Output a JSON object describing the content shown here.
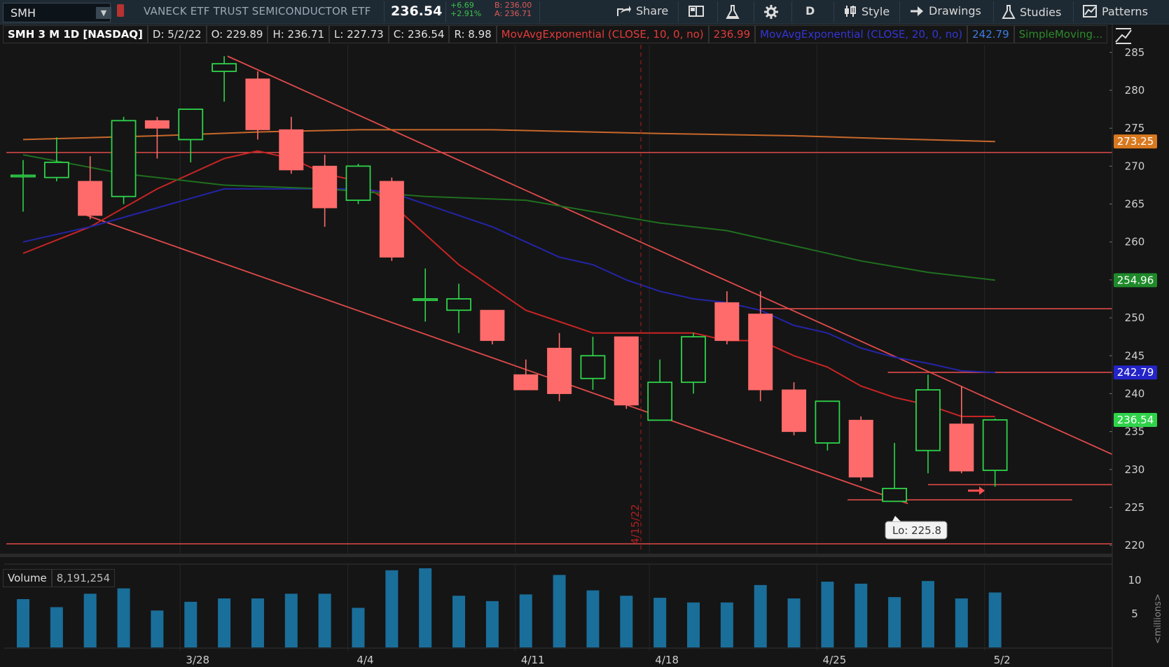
{
  "toolbar": {
    "symbol": "SMH",
    "description": "VANECK ETF TRUST SEMICONDUCTOR ETF",
    "last": "236.54",
    "change": "+6.69",
    "change_pct": "+2.91%",
    "bid": "B: 236.00",
    "ask": "A: 236.71",
    "share_label": "Share",
    "period_label": "D",
    "style_label": "Style",
    "drawings_label": "Drawings",
    "studies_label": "Studies",
    "patterns_label": "Patterns"
  },
  "infobar": {
    "title": "SMH 3 M 1D [NASDAQ]",
    "date": "D: 5/2/22",
    "open": "O: 229.89",
    "high": "H: 236.71",
    "low": "L: 227.73",
    "close": "C: 236.54",
    "range": "R: 8.98",
    "ema10_label": "MovAvgExponential (CLOSE, 10, 0, no)",
    "ema10_value": "236.99",
    "ema20_label": "MovAvgExponential (CLOSE, 20, 0, no)",
    "ema20_value": "242.79",
    "sma_label": "SimpleMoving..."
  },
  "volume_panel": {
    "label": "Volume",
    "value": "8,191,254",
    "unit_label": "<millions>"
  },
  "annotations": {
    "low_label": "Lo: 225.8",
    "vline_label": "4/15/22"
  },
  "colors": {
    "up": "#2fd34a",
    "down": "#ff6b6b",
    "ema10": "#c82424",
    "ema20": "#2424a8",
    "sma_green": "#1f6f1f",
    "sma_orange": "#c8682a",
    "trendline": "#e04a4a",
    "volume": "#1a6e9a",
    "background": "#151515"
  },
  "chart_data": {
    "type": "candlestick",
    "title": "SMH 3 M 1D [NASDAQ]",
    "ylim": [
      219,
      286
    ],
    "yticks": [
      220,
      225,
      230,
      235,
      240,
      245,
      250,
      255,
      260,
      265,
      270,
      275,
      280,
      285
    ],
    "x_tick_labels": [
      {
        "label": "3/28",
        "index": 5
      },
      {
        "label": "4/4",
        "index": 10
      },
      {
        "label": "4/11",
        "index": 15
      },
      {
        "label": "4/18",
        "index": 19
      },
      {
        "label": "4/25",
        "index": 24
      },
      {
        "label": "5/2",
        "index": 29
      }
    ],
    "candles": [
      {
        "o": 268.6,
        "h": 270.8,
        "l": 264.0,
        "c": 268.8
      },
      {
        "o": 268.5,
        "h": 273.8,
        "l": 268.0,
        "c": 270.5
      },
      {
        "o": 268.0,
        "h": 271.3,
        "l": 263.0,
        "c": 263.5
      },
      {
        "o": 266.0,
        "h": 276.5,
        "l": 265.0,
        "c": 276.0
      },
      {
        "o": 276.0,
        "h": 276.5,
        "l": 271.0,
        "c": 275.0
      },
      {
        "o": 273.5,
        "h": 277.5,
        "l": 270.5,
        "c": 277.5
      },
      {
        "o": 282.5,
        "h": 284.5,
        "l": 278.5,
        "c": 283.5
      },
      {
        "o": 281.5,
        "h": 282.5,
        "l": 273.5,
        "c": 274.8
      },
      {
        "o": 274.8,
        "h": 276.5,
        "l": 269.0,
        "c": 269.5
      },
      {
        "o": 270.0,
        "h": 271.5,
        "l": 262.0,
        "c": 264.5
      },
      {
        "o": 265.5,
        "h": 270.3,
        "l": 265.0,
        "c": 270.0
      },
      {
        "o": 268.0,
        "h": 268.5,
        "l": 257.5,
        "c": 258.0
      },
      {
        "o": 252.3,
        "h": 256.5,
        "l": 249.5,
        "c": 252.5
      },
      {
        "o": 251.0,
        "h": 254.5,
        "l": 248.0,
        "c": 252.5
      },
      {
        "o": 251.0,
        "h": 251.0,
        "l": 246.5,
        "c": 247.0
      },
      {
        "o": 242.5,
        "h": 244.5,
        "l": 240.5,
        "c": 240.5
      },
      {
        "o": 246.0,
        "h": 248.0,
        "l": 239.0,
        "c": 240.0
      },
      {
        "o": 242.0,
        "h": 247.5,
        "l": 240.5,
        "c": 245.0
      },
      {
        "o": 247.5,
        "h": 247.5,
        "l": 238.0,
        "c": 238.5
      },
      {
        "o": 236.5,
        "h": 244.5,
        "l": 236.5,
        "c": 241.5
      },
      {
        "o": 241.5,
        "h": 248.0,
        "l": 240.0,
        "c": 247.5
      },
      {
        "o": 252.0,
        "h": 253.5,
        "l": 246.5,
        "c": 247.0
      },
      {
        "o": 250.5,
        "h": 253.5,
        "l": 239.0,
        "c": 240.5
      },
      {
        "o": 240.5,
        "h": 241.5,
        "l": 234.5,
        "c": 235.0
      },
      {
        "o": 233.5,
        "h": 239.0,
        "l": 232.5,
        "c": 239.0
      },
      {
        "o": 236.5,
        "h": 237.0,
        "l": 228.5,
        "c": 229.0
      },
      {
        "o": 225.8,
        "h": 233.5,
        "l": 225.8,
        "c": 227.5
      },
      {
        "o": 232.5,
        "h": 242.5,
        "l": 229.5,
        "c": 240.5
      },
      {
        "o": 236.0,
        "h": 241.0,
        "l": 229.5,
        "c": 229.8
      },
      {
        "o": 229.89,
        "h": 236.71,
        "l": 227.73,
        "c": 236.54
      }
    ],
    "volume": {
      "ylim": [
        0,
        12
      ],
      "yticks": [
        5,
        10
      ],
      "values": [
        7.2,
        6.0,
        8.0,
        8.8,
        5.5,
        6.8,
        7.3,
        7.3,
        8.0,
        8.0,
        5.9,
        11.5,
        11.8,
        7.7,
        6.9,
        7.9,
        10.8,
        8.5,
        7.7,
        7.4,
        6.7,
        6.7,
        9.3,
        7.3,
        9.8,
        9.5,
        7.5,
        9.9,
        7.3,
        8.19
      ]
    },
    "moving_averages": [
      {
        "name": "MovAvgExponential (CLOSE, 10, 0, no)",
        "color": "#c82424",
        "points": [
          [
            0,
            258.5
          ],
          [
            2,
            262
          ],
          [
            4,
            267
          ],
          [
            6,
            271
          ],
          [
            7,
            272
          ],
          [
            8,
            271
          ],
          [
            9,
            269
          ],
          [
            10,
            268
          ],
          [
            11,
            265
          ],
          [
            12,
            261
          ],
          [
            13,
            257
          ],
          [
            14,
            254
          ],
          [
            15,
            251
          ],
          [
            16,
            249.5
          ],
          [
            17,
            248
          ],
          [
            18,
            248
          ],
          [
            19,
            248
          ],
          [
            20,
            248
          ],
          [
            21,
            247
          ],
          [
            22,
            247
          ],
          [
            23,
            245
          ],
          [
            24,
            243.5
          ],
          [
            25,
            241
          ],
          [
            26,
            239.5
          ],
          [
            27,
            238.5
          ],
          [
            28,
            237
          ],
          [
            29,
            236.99
          ]
        ]
      },
      {
        "name": "MovAvgExponential (CLOSE, 20, 0, no)",
        "color": "#2424a8",
        "points": [
          [
            0,
            260
          ],
          [
            2,
            262
          ],
          [
            4,
            264.5
          ],
          [
            6,
            267
          ],
          [
            8,
            267
          ],
          [
            10,
            267
          ],
          [
            11,
            266.5
          ],
          [
            12,
            265
          ],
          [
            13,
            263.5
          ],
          [
            14,
            262
          ],
          [
            15,
            260
          ],
          [
            16,
            258
          ],
          [
            17,
            257
          ],
          [
            18,
            255
          ],
          [
            19,
            253.5
          ],
          [
            20,
            252.5
          ],
          [
            21,
            252
          ],
          [
            22,
            251
          ],
          [
            23,
            249
          ],
          [
            24,
            248
          ],
          [
            25,
            246
          ],
          [
            26,
            244.8
          ],
          [
            27,
            244
          ],
          [
            28,
            243
          ],
          [
            29,
            242.79
          ]
        ]
      },
      {
        "name": "SimpleMoving (green)",
        "color": "#1f6f1f",
        "points": [
          [
            0,
            271.5
          ],
          [
            3,
            269
          ],
          [
            6,
            267.5
          ],
          [
            9,
            267
          ],
          [
            12,
            266
          ],
          [
            15,
            265.5
          ],
          [
            17,
            264
          ],
          [
            19,
            262.5
          ],
          [
            21,
            261.5
          ],
          [
            23,
            259.5
          ],
          [
            25,
            257.5
          ],
          [
            27,
            256
          ],
          [
            29,
            254.96
          ]
        ]
      },
      {
        "name": "SimpleMoving (orange)",
        "color": "#c8682a",
        "points": [
          [
            0,
            273.5
          ],
          [
            4,
            274
          ],
          [
            7,
            274.5
          ],
          [
            10,
            274.8
          ],
          [
            14,
            274.8
          ],
          [
            19,
            274.3
          ],
          [
            23,
            274
          ],
          [
            26,
            273.6
          ],
          [
            29,
            273.25
          ]
        ]
      }
    ],
    "price_tags": [
      {
        "value": 273.25,
        "text": "273.25",
        "bg": "#d9791f",
        "fg": "#ffffff"
      },
      {
        "value": 254.96,
        "text": "254.96",
        "bg": "#1f8a2a",
        "fg": "#ffffff"
      },
      {
        "value": 242.79,
        "text": "242.79",
        "bg": "#2424c8",
        "fg": "#ffffff"
      },
      {
        "value": 236.54,
        "text": "236.54",
        "bg": "#2fd34a",
        "fg": "#ffffff"
      }
    ],
    "horizontal_lines": [
      {
        "value": 271.8,
        "from": -0.5,
        "to": 32.5
      },
      {
        "value": 251.2,
        "from": 22,
        "to": 32.5
      },
      {
        "value": 242.8,
        "from": 25.8,
        "to": 32.5
      },
      {
        "value": 228.0,
        "from": 27,
        "to": 32.5
      },
      {
        "value": 226.0,
        "from": 24.6,
        "to": 31.3
      },
      {
        "value": 220.2,
        "from": -0.5,
        "to": 32.5
      }
    ],
    "trendlines": [
      {
        "from": [
          6.1,
          284.5
        ],
        "to": [
          32.5,
          232.0
        ]
      },
      {
        "from": [
          1.9,
          263.5
        ],
        "to": [
          26.4,
          225.5
        ]
      }
    ]
  }
}
